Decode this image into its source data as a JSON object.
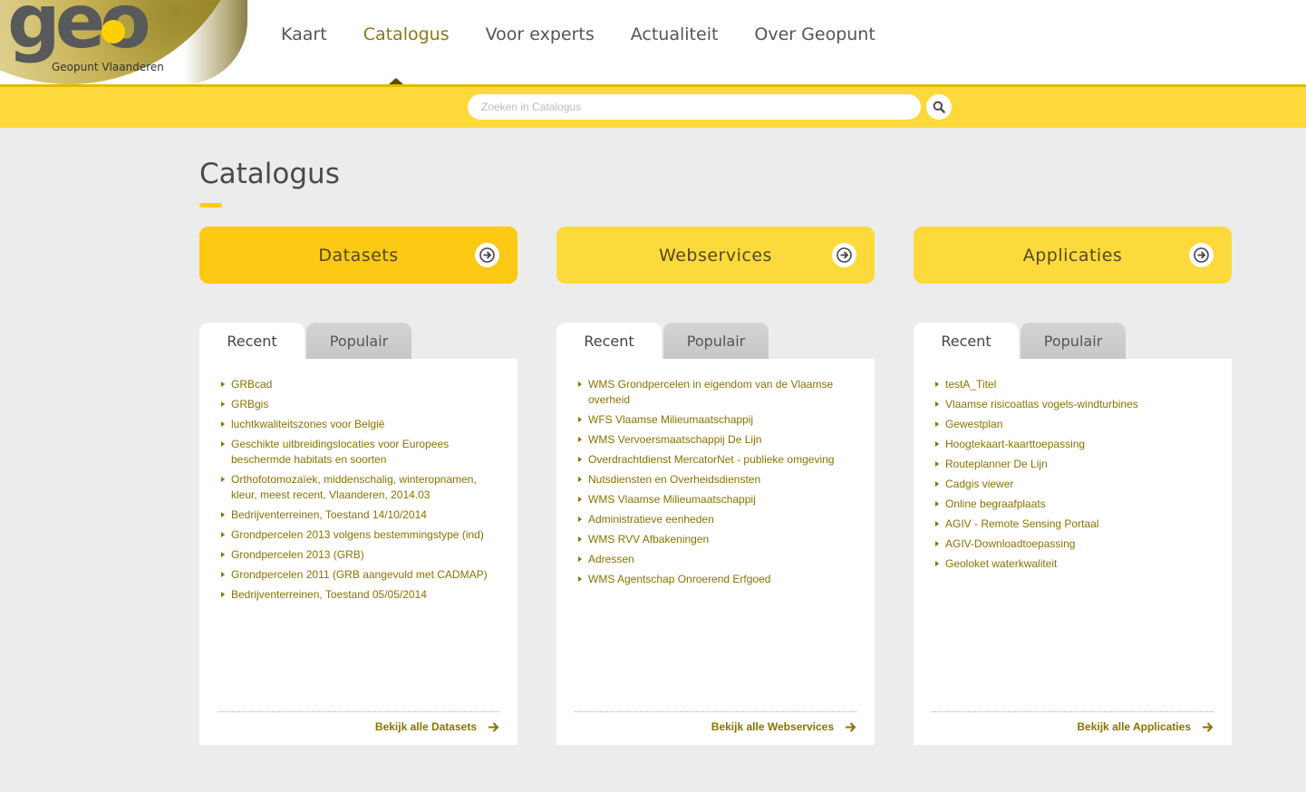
{
  "header": {
    "logo_text": "geo",
    "logo_subtitle": "Geopunt Vlaanderen",
    "nav": [
      {
        "label": "Kaart"
      },
      {
        "label": "Catalogus",
        "active": true
      },
      {
        "label": "Voor experts"
      },
      {
        "label": "Actualiteit"
      },
      {
        "label": "Over Geopunt"
      }
    ]
  },
  "search": {
    "placeholder": "Zoeken in Catalogus",
    "value": "",
    "button_icon": "search-icon"
  },
  "main": {
    "title": "Catalogus",
    "columns": [
      {
        "category": "Datasets",
        "tabs": [
          "Recent",
          "Populair"
        ],
        "active_tab": "Recent",
        "items": [
          "GRBcad",
          "GRBgis",
          "luchtkwaliteitszones voor België",
          "Geschikte uitbreidingslocaties voor Europees beschermde habitats en soorten",
          "Orthofotomozaïek, middenschalig, winteropnamen, kleur, meest recent, Vlaanderen, 2014.03",
          "Bedrijventerreinen, Toestand 14/10/2014",
          "Grondpercelen 2013 volgens bestemmingstype (ind)",
          "Grondpercelen 2013 (GRB)",
          "Grondpercelen 2011 (GRB aangevuld met CADMAP)",
          "Bedrijventerreinen, Toestand 05/05/2014"
        ],
        "link": "Bekijk alle Datasets"
      },
      {
        "category": "Webservices",
        "tabs": [
          "Recent",
          "Populair"
        ],
        "active_tab": "Recent",
        "items": [
          "WMS Grondpercelen in eigendom van de Vlaamse overheid",
          "WFS Vlaamse Milieumaatschappij",
          "WMS Vervoersmaatschappij De Lijn",
          "Overdrachtdienst MercatorNet - publieke omgeving",
          "Nutsdiensten en Overheidsdiensten",
          "WMS Vlaamse Milieumaatschappij",
          "Administratieve eenheden",
          "WMS RVV Afbakeningen",
          "Adressen",
          "WMS Agentschap Onroerend Erfgoed"
        ],
        "link": "Bekijk alle Webservices"
      },
      {
        "category": "Applicaties",
        "tabs": [
          "Recent",
          "Populair"
        ],
        "active_tab": "Recent",
        "items": [
          "testA_Titel",
          "Vlaamse risicoatlas vogels-windturbines",
          "Gewestplan",
          "Hoogtekaart-kaarttoepassing",
          "Routeplanner De Lijn",
          "Cadgis viewer",
          "Online begraafplaats",
          "AGIV - Remote Sensing Portaal",
          "AGIV-Downloadtoepassing",
          "Geoloket waterkwaliteit"
        ],
        "link": "Bekijk alle Applicaties"
      }
    ]
  },
  "colors": {
    "accent": "#fcd000",
    "accent_dark": "#8a7200",
    "background": "#ececec"
  }
}
